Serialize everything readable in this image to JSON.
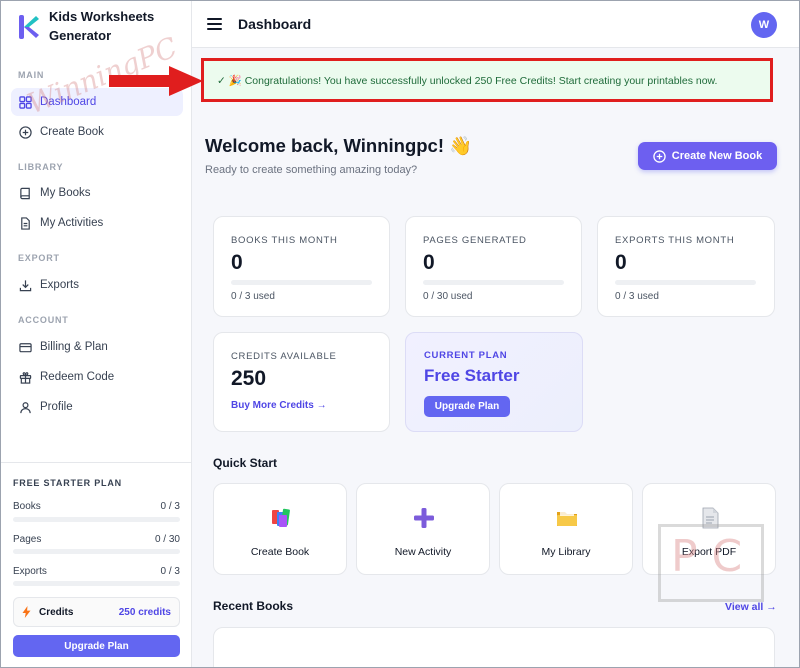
{
  "brand": {
    "name": "Kids Worksheets Generator"
  },
  "sidebar": {
    "sections": {
      "main": "MAIN",
      "library": "LIBRARY",
      "export": "EXPORT",
      "account": "ACCOUNT"
    },
    "items": {
      "dashboard": "Dashboard",
      "create_book": "Create Book",
      "my_books": "My Books",
      "my_activities": "My Activities",
      "exports": "Exports",
      "billing": "Billing & Plan",
      "redeem": "Redeem Code",
      "profile": "Profile"
    },
    "active_item": "dashboard",
    "plan": {
      "title": "FREE STARTER PLAN",
      "usage": [
        {
          "label": "Books",
          "value": "0 / 3",
          "fraction": 0
        },
        {
          "label": "Pages",
          "value": "0 / 30",
          "fraction": 0
        },
        {
          "label": "Exports",
          "value": "0 / 3",
          "fraction": 0
        }
      ],
      "credits_label": "Credits",
      "credits_value": "250 credits",
      "upgrade_label": "Upgrade Plan"
    }
  },
  "topbar": {
    "title": "Dashboard",
    "avatar_initial": "W"
  },
  "banner": {
    "text": "✓ 🎉 Congratulations! You have successfully unlocked 250 Free Credits! Start creating your printables now."
  },
  "welcome": {
    "title": "Welcome back, Winningpc! 👋",
    "subtitle": "Ready to create something amazing today?",
    "create_button": "Create New Book"
  },
  "stats": [
    {
      "label": "BOOKS THIS MONTH",
      "value": "0",
      "used": "0 / 3 used",
      "fraction": 0
    },
    {
      "label": "PAGES GENERATED",
      "value": "0",
      "used": "0 / 30 used",
      "fraction": 0
    },
    {
      "label": "EXPORTS THIS MONTH",
      "value": "0",
      "used": "0 / 3 used",
      "fraction": 0
    }
  ],
  "credits_card": {
    "label": "CREDITS AVAILABLE",
    "value": "250",
    "link": "Buy More Credits →"
  },
  "plan_card": {
    "label": "CURRENT PLAN",
    "name": "Free Starter",
    "button": "Upgrade Plan"
  },
  "quick_start": {
    "title": "Quick Start",
    "tiles": [
      {
        "label": "Create Book",
        "icon": "books-icon"
      },
      {
        "label": "New Activity",
        "icon": "plus-icon"
      },
      {
        "label": "My Library",
        "icon": "folder-icon"
      },
      {
        "label": "Export PDF",
        "icon": "document-icon"
      }
    ]
  },
  "recent_books": {
    "title": "Recent Books",
    "view_all": "View all →"
  },
  "watermark": {
    "text": "WinningPC",
    "pc": "PC"
  },
  "colors": {
    "accent": "#6366f1",
    "banner_bg": "#ecfbee",
    "banner_border": "#e01e1e",
    "arrow": "#e01e1e"
  }
}
